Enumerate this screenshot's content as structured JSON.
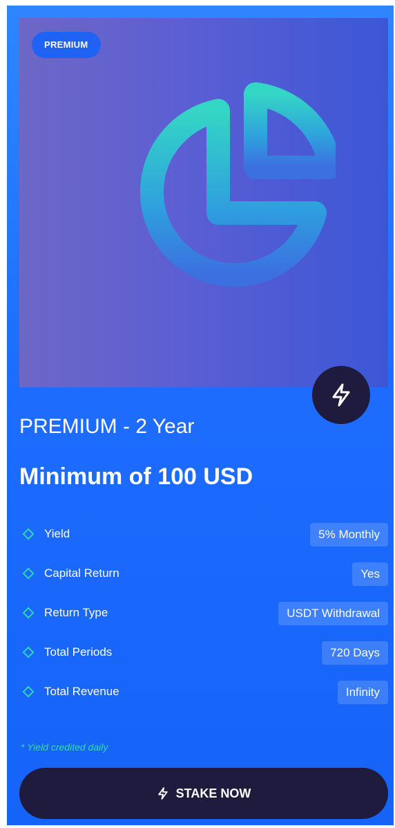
{
  "badge": "PREMIUM",
  "plan_title": "PREMIUM - 2 Year",
  "minimum": "Minimum of 100 USD",
  "details": [
    {
      "label": "Yield",
      "value": "5% Monthly"
    },
    {
      "label": "Capital Return",
      "value": "Yes"
    },
    {
      "label": "Return Type",
      "value": "USDT Withdrawal"
    },
    {
      "label": "Total Periods",
      "value": "720 Days"
    },
    {
      "label": "Total Revenue",
      "value": "Infinity"
    }
  ],
  "footnote": "* Yield credited daily",
  "stake_button": "STAKE NOW",
  "icons": {
    "hero": "pie-chart-icon",
    "bolt": "lightning-icon",
    "row": "diamond-icon"
  },
  "colors": {
    "accent": "#2bd8b3",
    "dark": "#1f1b3f",
    "card_blue": "#1e6dff"
  }
}
